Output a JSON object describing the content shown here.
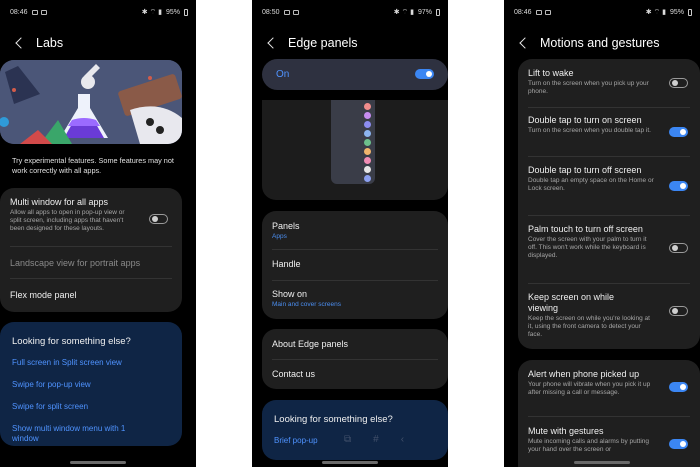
{
  "phone1": {
    "time": "08:46",
    "battery": "95%",
    "title": "Labs",
    "intro": "Try experimental features. Some features may not work correctly with all apps.",
    "multi_window": {
      "title": "Multi window for all apps",
      "desc": "Allow all apps to open in pop-up view or split screen, including apps that haven't been designed for these layouts.",
      "on": false
    },
    "landscape": "Landscape view for portrait apps",
    "flex_mode": "Flex mode panel",
    "looking_title": "Looking for something else?",
    "links": [
      "Full screen in Split screen view",
      "Swipe for pop-up view",
      "Swipe for split screen",
      "Show multi window menu with 1 window"
    ]
  },
  "phone2": {
    "time": "08:50",
    "battery": "97%",
    "title": "Edge panels",
    "on_label": "On",
    "on": true,
    "panels": {
      "title": "Panels",
      "sub": "Apps"
    },
    "handle": "Handle",
    "show_on": {
      "title": "Show on",
      "sub": "Main and cover screens"
    },
    "about": "About Edge panels",
    "contact": "Contact us",
    "looking_title": "Looking for something else?",
    "link": "Brief pop-up",
    "dot_colors": [
      "#f08c8c",
      "#c68cf0",
      "#8c8cf0",
      "#8cb4f0",
      "#6cc08c",
      "#f0b46c",
      "#f08cb4",
      "#e6e6e6",
      "#8ca0f0"
    ]
  },
  "phone3": {
    "time": "08:46",
    "battery": "95%",
    "title": "Motions and gestures",
    "items": [
      {
        "title": "Lift to wake",
        "desc": "Turn on the screen when you pick up your phone.",
        "on": false
      },
      {
        "title": "Double tap to turn on screen",
        "desc": "Turn on the screen when you double tap it.",
        "on": true
      },
      {
        "title": "Double tap to turn off screen",
        "desc": "Double tap an empty space on the Home or Lock screen.",
        "on": true
      },
      {
        "title": "Palm touch to turn off screen",
        "desc": "Cover the screen with your palm to turn it off. This won't work while the keyboard is displayed.",
        "on": false
      },
      {
        "title": "Keep screen on while viewing",
        "desc": "Keep the screen on while you're looking at it, using the front camera to detect your face.",
        "on": false
      }
    ],
    "items2": [
      {
        "title": "Alert when phone picked up",
        "desc": "Your phone will vibrate when you pick it up after missing a call or message.",
        "on": true
      },
      {
        "title": "Mute with gestures",
        "desc": "Mute incoming calls and alarms by putting your hand over the screen or",
        "on": true
      }
    ]
  }
}
